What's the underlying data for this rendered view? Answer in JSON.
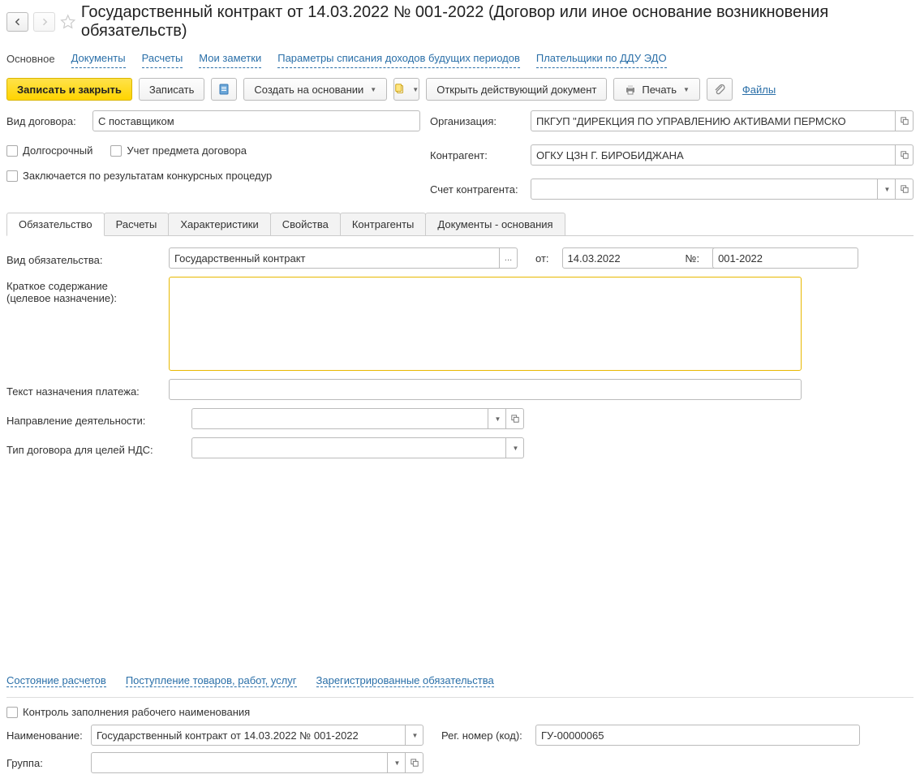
{
  "header": {
    "title": "Государственный контракт от 14.03.2022 № 001-2022 (Договор или иное основание возникновения обязательств)"
  },
  "navlinks": {
    "main": "Основное",
    "docs": "Документы",
    "calc": "Расчеты",
    "notes": "Мои заметки",
    "params": "Параметры списания доходов будущих периодов",
    "payers": "Плательщики по ДДУ ЭДО"
  },
  "toolbar": {
    "save_close": "Записать и закрыть",
    "save": "Записать",
    "create_based": "Создать на основании",
    "open_current": "Открыть действующий документ",
    "print": "Печать",
    "files": "Файлы"
  },
  "top_form": {
    "contract_type_label": "Вид договора:",
    "contract_type_value": "С поставщиком",
    "longterm_label": "Долгосрочный",
    "subject_label": "Учет предмета договора",
    "tender_label": "Заключается по результатам конкурсных процедур",
    "org_label": "Организация:",
    "org_value": "ПКГУП \"ДИРЕКЦИЯ ПО УПРАВЛЕНИЮ АКТИВАМИ ПЕРМСКО",
    "counter_label": "Контрагент:",
    "counter_value": "ОГКУ ЦЗН Г. БИРОБИДЖАНА",
    "account_label": "Счет контрагента:",
    "account_value": ""
  },
  "tabs": {
    "t0": "Обязательство",
    "t1": "Расчеты",
    "t2": "Характеристики",
    "t3": "Свойства",
    "t4": "Контрагенты",
    "t5": "Документы - основания"
  },
  "obl": {
    "type_label": "Вид обязательства:",
    "type_value": "Государственный контракт",
    "from_label": "от:",
    "from_value": "14.03.2022",
    "num_label": "№:",
    "num_value": "001-2022",
    "summary_label1": "Краткое содержание",
    "summary_label2": "(целевое назначение):",
    "summary_value": "",
    "payment_label": "Текст назначения платежа:",
    "payment_value": "",
    "direction_label": "Направление деятельности:",
    "direction_value": "",
    "vat_label": "Тип договора для целей НДС:",
    "vat_value": ""
  },
  "bottom_links": {
    "l1": "Состояние расчетов",
    "l2": "Поступление товаров, работ, услуг",
    "l3": "Зарегистрированные обязательства"
  },
  "footer": {
    "control_label": "Контроль заполнения рабочего наименования",
    "name_label": "Наименование:",
    "name_value": "Государственный контракт от 14.03.2022 № 001-2022",
    "reg_label": "Рег. номер (код):",
    "reg_value": "ГУ-00000065",
    "group_label": "Группа:",
    "group_value": ""
  }
}
